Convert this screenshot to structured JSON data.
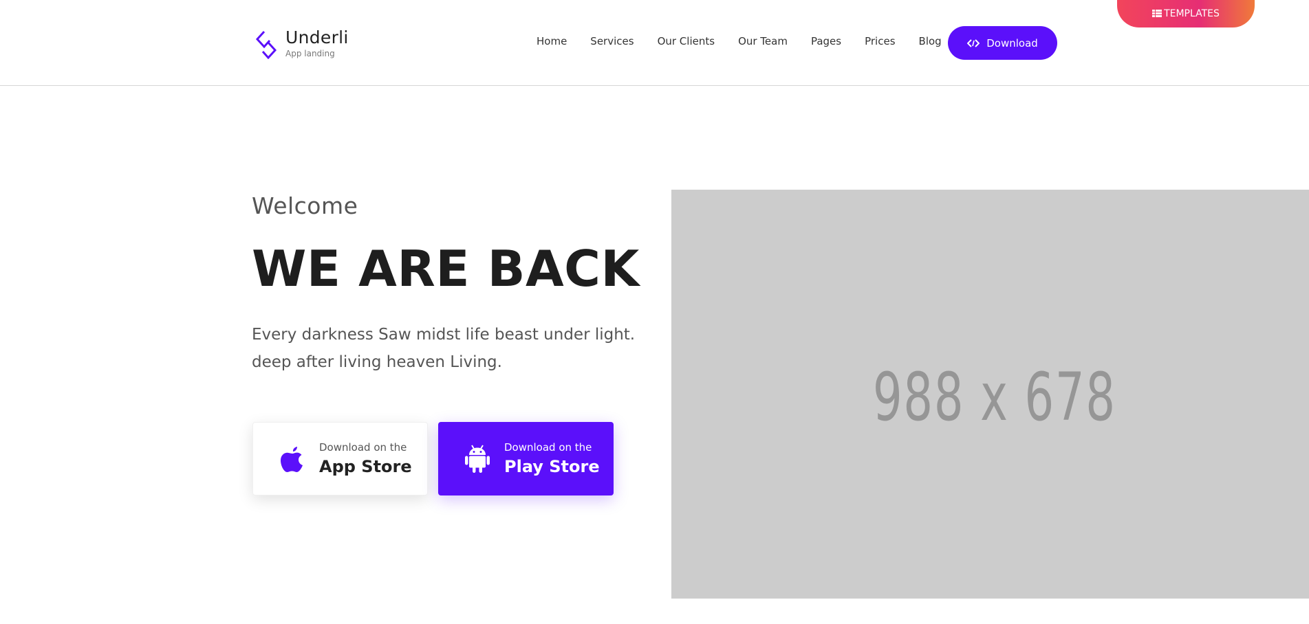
{
  "brand": {
    "name": "Underli",
    "tagline": "App landing",
    "logo_icon": "diamond-logo-icon",
    "accent_color": "#5b10fa"
  },
  "nav": {
    "items": [
      {
        "label": "Home"
      },
      {
        "label": "Services"
      },
      {
        "label": "Our Clients"
      },
      {
        "label": "Our Team"
      },
      {
        "label": "Pages"
      },
      {
        "label": "Prices"
      },
      {
        "label": "Blog"
      }
    ]
  },
  "header_button": {
    "label": "Download",
    "icon": "code-icon"
  },
  "templates_tab": {
    "label": "TEMPLATES",
    "icon": "grid-icon",
    "gradient": [
      "#f2455b",
      "#e62e74",
      "#f07a3a"
    ]
  },
  "hero": {
    "welcome": "Welcome",
    "title": "WE ARE BACK",
    "desc_line1": "Every darkness Saw midst life beast under light.",
    "desc_line2": "deep after living heaven Living.",
    "app_store": {
      "small": "Download on the",
      "big": "App Store",
      "icon": "apple-icon"
    },
    "play_store": {
      "small": "Download on the",
      "big": "Play Store",
      "icon": "android-icon"
    }
  },
  "placeholder": {
    "text": "988 x 678",
    "background": "#cccccc"
  }
}
